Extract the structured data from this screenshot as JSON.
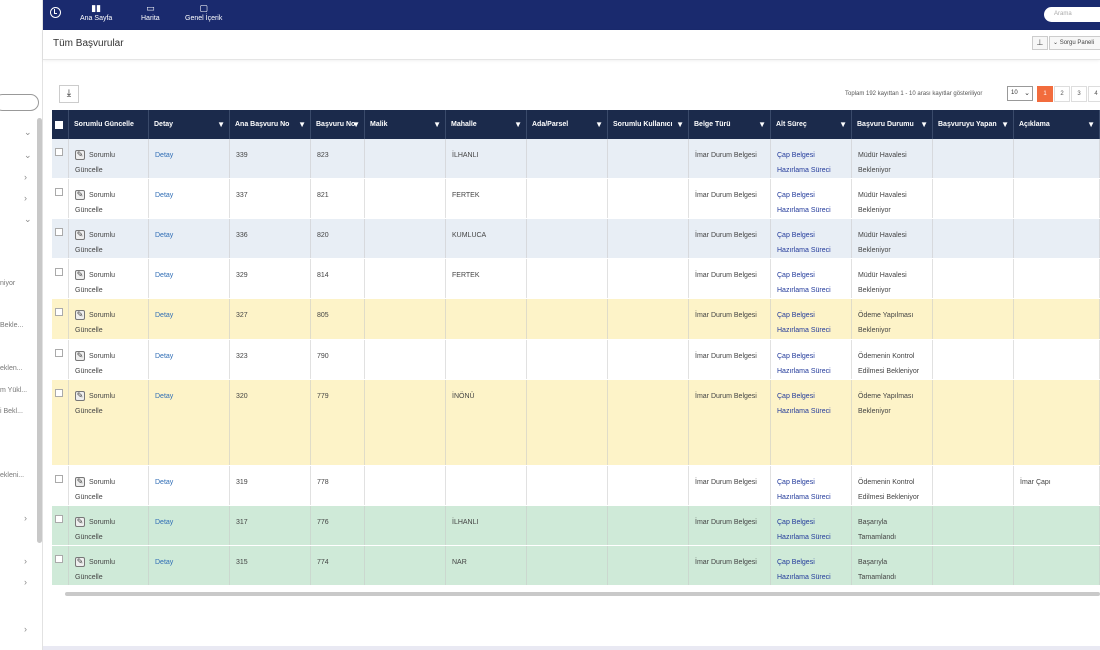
{
  "nav": {
    "items": [
      {
        "label": "Ana Sayfa",
        "icon": "bar-chart-icon"
      },
      {
        "label": "Harita",
        "icon": "map-icon"
      },
      {
        "label": "Genel İçerik",
        "icon": "monitor-icon"
      }
    ],
    "search_placeholder": "Arama"
  },
  "sidebar": {
    "snippets": [
      "niyor",
      "Beklе...",
      "eklen...",
      "m Yükl...",
      "i Bekl...",
      "ekleni..."
    ]
  },
  "page": {
    "title": "Tüm Başvurular",
    "query_panel_label": "Sorgu Paneli"
  },
  "toolbar": {
    "summary": "Toplam 192 kayıttan 1 - 10 arası kayıtlar gösteriliyor",
    "page_size": "10",
    "pages": [
      "1",
      "2",
      "3",
      "4"
    ],
    "active_page": "1"
  },
  "colors": {
    "nav_bg": "#1a2a6e",
    "header_bg": "#1b2a4b",
    "row_blue": "#e8eef5",
    "row_white": "#ffffff",
    "row_yellow": "#fdf3c8",
    "row_green": "#cfead8",
    "active_page": "#f26c3d"
  },
  "table": {
    "columns": [
      "",
      "Sorumlu Güncelle",
      "Detay",
      "Ana Başvuru No",
      "Başvuru No",
      "Malik",
      "Mahalle",
      "Ada/Parsel",
      "Sorumlu Kullanıcı",
      "Belge Türü",
      "Alt Süreç",
      "Başvuru Durumu",
      "Başvuruyu Yapan",
      "Açıklama"
    ],
    "rows": [
      {
        "update1": "Sorumlu",
        "update2": "Güncelle",
        "detail": "Detay",
        "main_no": "339",
        "app_no": "823",
        "owner": "",
        "district": "İLHANLI",
        "parcel": "",
        "user": "",
        "doc": "İmar Durum Belgesi",
        "sub1": "Çap Belgesi",
        "sub2": "Hazırlama Süreci",
        "status1": "Müdür Havalesi",
        "status2": "Bekleniyor",
        "applicant": "",
        "note": "",
        "color": "blue"
      },
      {
        "update1": "Sorumlu",
        "update2": "Güncelle",
        "detail": "Detay",
        "main_no": "337",
        "app_no": "821",
        "owner": "",
        "district": "FERTEK",
        "parcel": "",
        "user": "",
        "doc": "İmar Durum Belgesi",
        "sub1": "Çap Belgesi",
        "sub2": "Hazırlama Süreci",
        "status1": "Müdür Havalesi",
        "status2": "Bekleniyor",
        "applicant": "",
        "note": "",
        "color": "white"
      },
      {
        "update1": "Sorumlu",
        "update2": "Güncelle",
        "detail": "Detay",
        "main_no": "336",
        "app_no": "820",
        "owner": "",
        "district": "KUMLUCA",
        "parcel": "",
        "user": "",
        "doc": "İmar Durum Belgesi",
        "sub1": "Çap Belgesi",
        "sub2": "Hazırlama Süreci",
        "status1": "Müdür Havalesi",
        "status2": "Bekleniyor",
        "applicant": "",
        "note": "",
        "color": "blue"
      },
      {
        "update1": "Sorumlu",
        "update2": "Güncelle",
        "detail": "Detay",
        "main_no": "329",
        "app_no": "814",
        "owner": "",
        "district": "FERTEK",
        "parcel": "",
        "user": "",
        "doc": "İmar Durum Belgesi",
        "sub1": "Çap Belgesi",
        "sub2": "Hazırlama Süreci",
        "status1": "Müdür Havalesi",
        "status2": "Bekleniyor",
        "applicant": "",
        "note": "",
        "color": "white"
      },
      {
        "update1": "Sorumlu",
        "update2": "Güncelle",
        "detail": "Detay",
        "main_no": "327",
        "app_no": "805",
        "owner": "",
        "district": "",
        "parcel": "",
        "user": "",
        "doc": "İmar Durum Belgesi",
        "sub1": "Çap Belgesi",
        "sub2": "Hazırlama Süreci",
        "status1": "Ödeme Yapılması",
        "status2": "Bekleniyor",
        "applicant": "",
        "note": "",
        "color": "yellow"
      },
      {
        "update1": "Sorumlu",
        "update2": "Güncelle",
        "detail": "Detay",
        "main_no": "323",
        "app_no": "790",
        "owner": "",
        "district": "",
        "parcel": "",
        "user": "",
        "doc": "İmar Durum Belgesi",
        "sub1": "Çap Belgesi",
        "sub2": "Hazırlama Süreci",
        "status1": "Ödemenin Kontrol",
        "status2": "Edilmesi Bekleniyor",
        "applicant": "",
        "note": "",
        "color": "white"
      },
      {
        "update1": "Sorumlu",
        "update2": "Güncelle",
        "detail": "Detay",
        "main_no": "320",
        "app_no": "779",
        "owner": "",
        "district": "İNÖNÜ",
        "parcel": "",
        "user": "",
        "doc": "İmar Durum Belgesi",
        "sub1": "Çap Belgesi",
        "sub2": "Hazırlama Süreci",
        "status1": "Ödeme Yapılması",
        "status2": "Bekleniyor",
        "applicant": "",
        "note": "",
        "color": "yellow"
      },
      {
        "update1": "Sorumlu",
        "update2": "Güncelle",
        "detail": "Detay",
        "main_no": "319",
        "app_no": "778",
        "owner": "",
        "district": "",
        "parcel": "",
        "user": "",
        "doc": "İmar Durum Belgesi",
        "sub1": "Çap Belgesi",
        "sub2": "Hazırlama Süreci",
        "status1": "Ödemenin Kontrol",
        "status2": "Edilmesi Bekleniyor",
        "applicant": "",
        "note": "İmar Çapı",
        "color": "white"
      },
      {
        "update1": "Sorumlu",
        "update2": "Güncelle",
        "detail": "Detay",
        "main_no": "317",
        "app_no": "776",
        "owner": "",
        "district": "İLHANLI",
        "parcel": "",
        "user": "",
        "doc": "İmar Durum Belgesi",
        "sub1": "Çap Belgesi",
        "sub2": "Hazırlama Süreci",
        "status1": "Başarıyla",
        "status2": "Tamamlandı",
        "applicant": "",
        "note": "",
        "color": "green"
      },
      {
        "update1": "Sorumlu",
        "update2": "Güncelle",
        "detail": "Detay",
        "main_no": "315",
        "app_no": "774",
        "owner": "",
        "district": "NAR",
        "parcel": "",
        "user": "",
        "doc": "İmar Durum Belgesi",
        "sub1": "Çap Belgesi",
        "sub2": "Hazırlama Süreci",
        "status1": "Başarıyla",
        "status2": "Tamamlandı",
        "applicant": "",
        "note": "",
        "color": "green"
      }
    ]
  }
}
